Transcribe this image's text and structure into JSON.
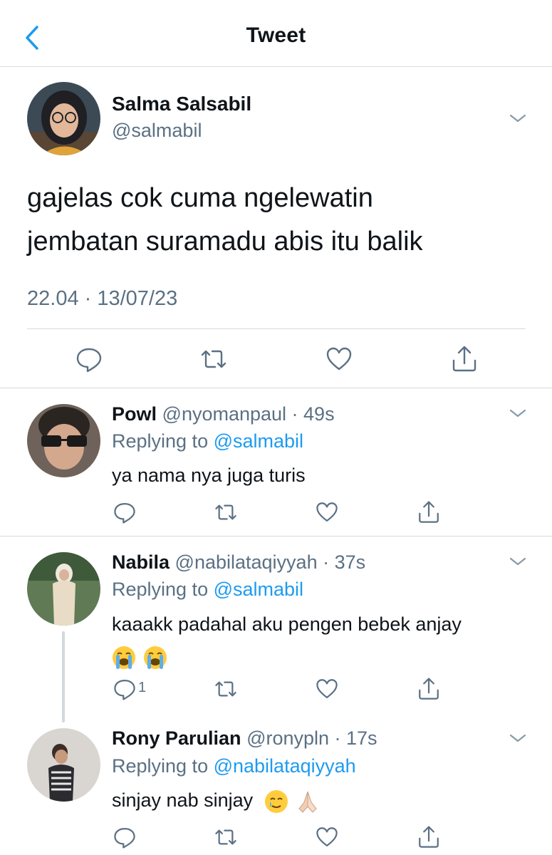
{
  "header": {
    "title": "Tweet"
  },
  "tweet": {
    "author_name": "Salma Salsabil",
    "author_handle": "@salmabil",
    "text_line1": "gajelas cok cuma ngelewatin",
    "text_line2": "jembatan suramadu abis itu balik",
    "timestamp": "22.04 · 13/07/23"
  },
  "replies": [
    {
      "name": "Powl",
      "meta": "@nyomanpaul · 49s",
      "replying_prefix": "Replying to ",
      "replying_handle": "@salmabil",
      "text": "ya nama nya juga turis",
      "reply_count": ""
    },
    {
      "name": "Nabila",
      "meta": "@nabilataqiyyah · 37s",
      "replying_prefix": "Replying to ",
      "replying_handle": "@salmabil",
      "text": "kaaakk padahal aku pengen bebek anjay",
      "reply_count": "1"
    },
    {
      "name": "Rony Parulian",
      "meta": "@ronypln · 17s",
      "replying_prefix": "Replying to ",
      "replying_handle": "@nabilataqiyyah",
      "text": "sinjay nab sinjay",
      "reply_count": ""
    }
  ],
  "icons": {
    "back": "chevron-left-icon",
    "more": "chevron-down-icon",
    "reply": "comment-icon",
    "retweet": "retweet-icon",
    "like": "heart-icon",
    "share": "share-icon",
    "emoji_crying": "loudly-crying-face-emoji",
    "emoji_tear": "smiling-face-with-tear-emoji",
    "emoji_pray": "folded-hands-emoji"
  },
  "colors": {
    "accent": "#1d9bf0",
    "secondary_text": "#5b7083",
    "divider": "#d6d9dc"
  }
}
